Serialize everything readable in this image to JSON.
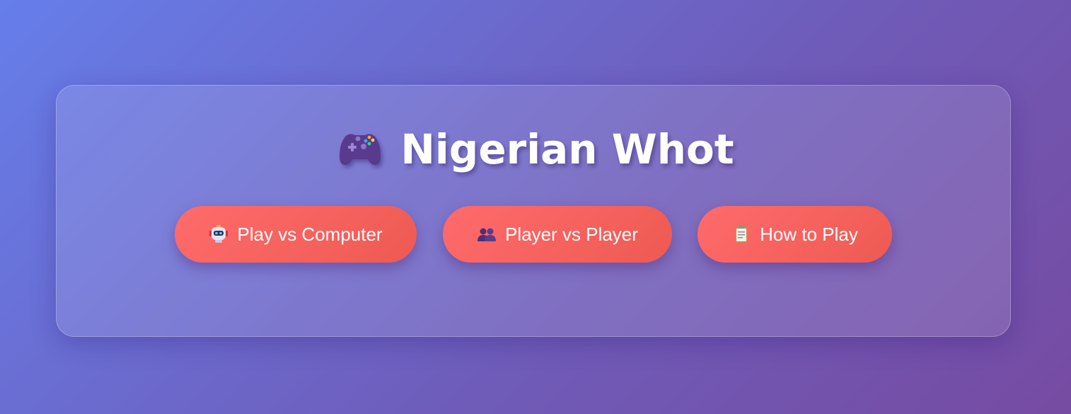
{
  "header": {
    "title": "Nigerian Whot",
    "title_icon": "game-controller-icon"
  },
  "menu": {
    "buttons": [
      {
        "label": "Play vs Computer",
        "icon": "robot-icon"
      },
      {
        "label": "Player vs Player",
        "icon": "two-players-icon"
      },
      {
        "label": "How to Play",
        "icon": "clipboard-icon"
      }
    ]
  },
  "colors": {
    "background_start": "#667eea",
    "background_end": "#764ba2",
    "button_start": "#ff6b6b",
    "button_end": "#ee5a52",
    "text": "#ffffff"
  }
}
